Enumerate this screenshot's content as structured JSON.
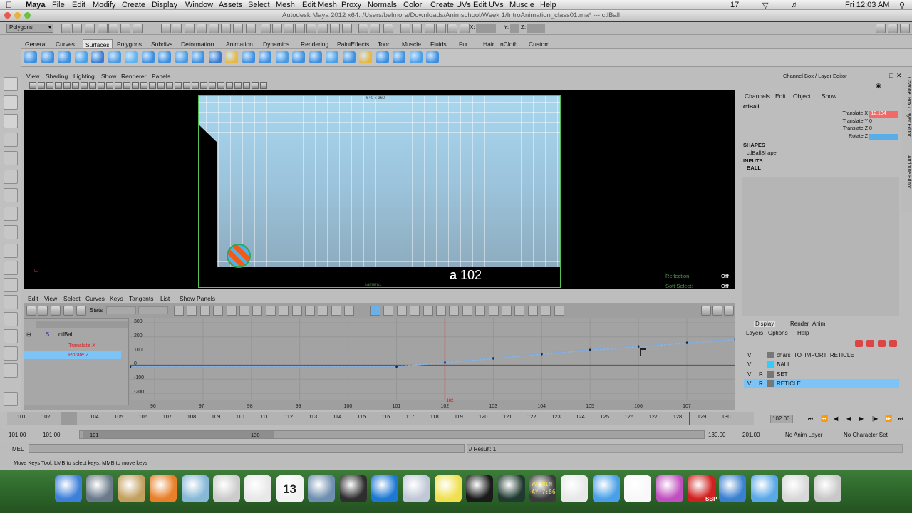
{
  "mac_menu": {
    "app": "Maya",
    "items": [
      "File",
      "Edit",
      "Modify",
      "Create",
      "Display",
      "Window",
      "Assets",
      "Select",
      "Mesh",
      "Edit Mesh",
      "Proxy",
      "Normals",
      "Color",
      "Create UVs",
      "Edit UVs",
      "Muscle",
      "Help"
    ],
    "status_num": "17",
    "clock": "Fri 12:03 AM"
  },
  "window": {
    "title": "Autodesk Maya 2012 x64: /Users/belmore/Downloads/Animschool/Week 1/IntroAnimation_class01.ma*  ---  ctlBall"
  },
  "status_line": {
    "mode": "Polygons",
    "x_label": "X:",
    "y_label": "Y:",
    "z_label": "Z:"
  },
  "shelf": {
    "tabs": [
      "General",
      "Curves",
      "Surfaces",
      "Polygons",
      "Subdivs",
      "Deformation",
      "Animation",
      "Dynamics",
      "Rendering",
      "PaintEffects",
      "Toon",
      "Muscle",
      "Fluids",
      "Fur",
      "Hair",
      "nCloth",
      "Custom"
    ],
    "active_tab": "Surfaces"
  },
  "viewport": {
    "menu": [
      "View",
      "Shading",
      "Lighting",
      "Show",
      "Renderer",
      "Panels"
    ],
    "resolution": "640 x 360",
    "camera_label": "camera1",
    "frame_number": "102",
    "hud": [
      {
        "label": "Reflection:",
        "value": "Off"
      },
      {
        "label": "Soft Select:",
        "value": "Off"
      }
    ]
  },
  "graph_editor": {
    "menu": [
      "Edit",
      "View",
      "Select",
      "Curves",
      "Keys",
      "Tangents",
      "List",
      "Show",
      "Panels"
    ],
    "stats_label": "Stats",
    "outliner": [
      {
        "label": "ctlBall"
      },
      {
        "label": "Translate X"
      },
      {
        "label": "Rotate Z"
      }
    ],
    "y_ticks": [
      "300",
      "200",
      "100",
      "0",
      "-100",
      "-200"
    ],
    "x_ticks": [
      "96",
      "97",
      "98",
      "99",
      "100",
      "101",
      "102",
      "103",
      "104",
      "105",
      "106",
      "107"
    ],
    "current_frame_marker": "102"
  },
  "chart_data": {
    "type": "line",
    "title": "",
    "xlabel": "",
    "ylabel": "",
    "xlim": [
      95.5,
      108
    ],
    "ylim": [
      -250,
      330
    ],
    "series": [
      {
        "name": "Translate X",
        "color": "#7fa8d6",
        "x": [
          95.5,
          101,
          102,
          103,
          104,
          105,
          106,
          107,
          108
        ],
        "y": [
          -12,
          -12,
          20,
          50,
          80,
          110,
          135,
          160,
          185
        ]
      },
      {
        "name": "Rotate Z",
        "color": "#8fb3e0",
        "x": [
          95.5,
          101,
          102,
          103,
          104,
          105,
          106,
          107,
          108
        ],
        "y": [
          -8,
          -8,
          16,
          46,
          76,
          105,
          130,
          156,
          180
        ]
      }
    ]
  },
  "channel_box": {
    "title": "Channel Box / Layer Editor",
    "menu": [
      "Channels",
      "Edit",
      "Object",
      "Show"
    ],
    "object": "ctlBall",
    "attrs": [
      {
        "label": "Translate X",
        "value": "-12.134"
      },
      {
        "label": "Translate Y",
        "value": "0"
      },
      {
        "label": "Translate Z",
        "value": "0"
      },
      {
        "label": "Rotate Z",
        "value": ""
      }
    ],
    "shapes_header": "SHAPES",
    "shape": "ctlBallShape",
    "inputs_header": "INPUTS",
    "input": "BALL",
    "side_tabs": [
      "Channel Box / Layer Editor",
      "Attribute Editor"
    ]
  },
  "layer_editor": {
    "tabs": [
      "Display",
      "Render",
      "Anim"
    ],
    "menu": [
      "Layers",
      "Options",
      "Help"
    ],
    "layers": [
      {
        "v": "V",
        "r": "",
        "color": "#777777",
        "name": "chars_TO_IMPORT_RETICLE",
        "selected": false
      },
      {
        "v": "V",
        "r": "",
        "color": "#33ccff",
        "name": "BALL",
        "selected": false
      },
      {
        "v": "V",
        "r": "R",
        "color": "#777777",
        "name": "SET",
        "selected": false
      },
      {
        "v": "V",
        "r": "R",
        "color": "#777777",
        "name": "RETICLE",
        "selected": true
      }
    ]
  },
  "time_slider": {
    "ticks": [
      "101",
      "102",
      "103",
      "104",
      "105",
      "106",
      "107",
      "108",
      "109",
      "110",
      "111",
      "112",
      "113",
      "114",
      "115",
      "116",
      "117",
      "118",
      "119",
      "120",
      "121",
      "122",
      "123",
      "124",
      "125",
      "126",
      "127",
      "128",
      "129",
      "130"
    ],
    "current": "102",
    "current_field": "102.00"
  },
  "range_slider": {
    "start": "101.00",
    "inner_start": "101.00",
    "range_start": "101",
    "range_end": "130",
    "inner_end": "130.00",
    "end": "201.00",
    "anim_layer": "No Anim Layer",
    "character_set": "No Character Set"
  },
  "command_line": {
    "label": "MEL",
    "result": "// Result: 1"
  },
  "help_line": {
    "text": "Move Keys Tool: LMB to select keys; MMB to move keys"
  },
  "dock": {
    "calendar_day": "13",
    "warning_text": "WARNIN",
    "warning_sub": "AY 7:86",
    "sbp_text": "SBP"
  }
}
